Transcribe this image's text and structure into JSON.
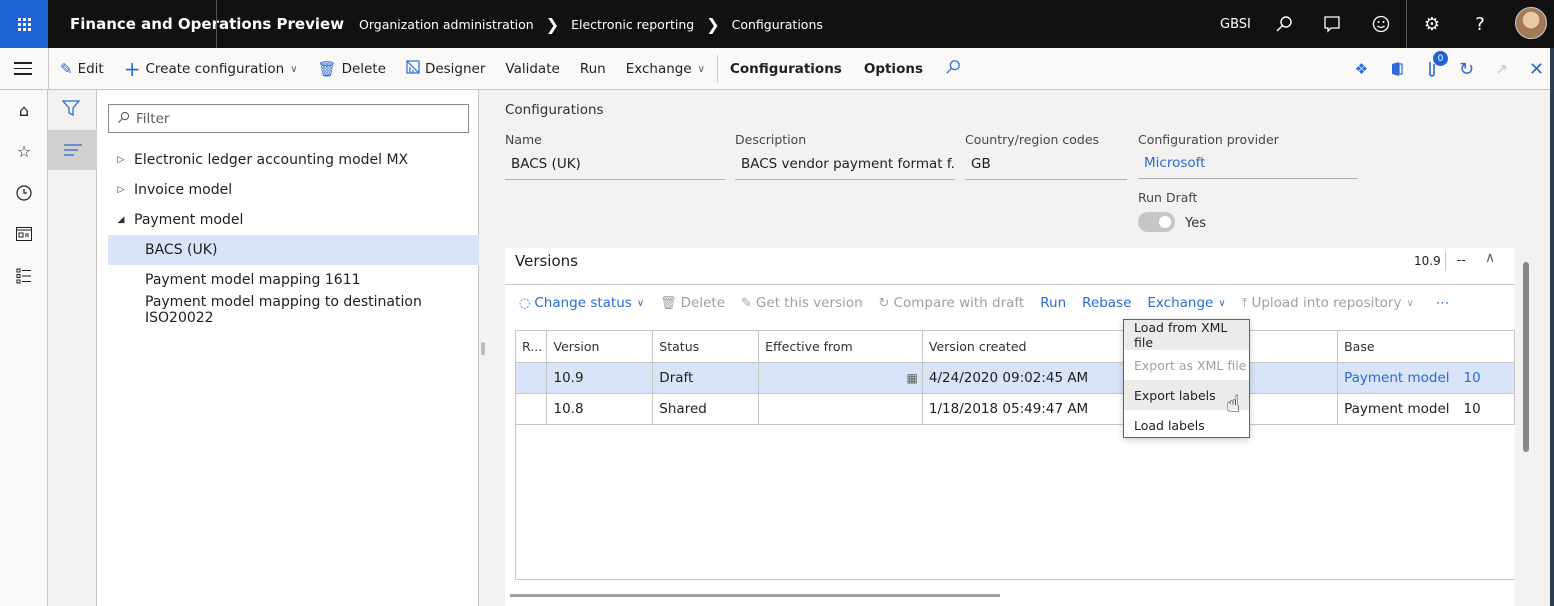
{
  "topbar": {
    "app_title": "Finance and Operations Preview",
    "breadcrumb": [
      "Organization administration",
      "Electronic reporting",
      "Configurations"
    ],
    "company": "GBSI",
    "icons": [
      "search-icon",
      "chat-icon",
      "smiley-icon",
      "gear-icon",
      "help-icon",
      "avatar"
    ]
  },
  "actionbar": {
    "edit": "Edit",
    "create_configuration": "Create configuration",
    "delete": "Delete",
    "designer": "Designer",
    "validate": "Validate",
    "run": "Run",
    "exchange": "Exchange",
    "configurations": "Configurations",
    "options": "Options",
    "notification_count": "0"
  },
  "tree": {
    "filter_placeholder": "Filter",
    "items": [
      {
        "label": "Electronic ledger accounting model MX",
        "state": "collapsed"
      },
      {
        "label": "Invoice model",
        "state": "collapsed"
      },
      {
        "label": "Payment model",
        "state": "expanded"
      },
      {
        "label": "BACS (UK)",
        "selected": true
      },
      {
        "label": "Payment model mapping 1611"
      },
      {
        "label": "Payment model mapping to destination ISO20022"
      }
    ]
  },
  "details": {
    "section": "Configurations",
    "name_label": "Name",
    "name_value": "BACS (UK)",
    "description_label": "Description",
    "description_value": "BACS vendor payment format f...",
    "country_label": "Country/region codes",
    "country_value": "GB",
    "provider_label": "Configuration provider",
    "provider_value": "Microsoft",
    "run_draft_label": "Run Draft",
    "run_draft_value": "Yes"
  },
  "versions": {
    "title": "Versions",
    "summary_version": "10.9",
    "summary_status": "--",
    "actions": {
      "change_status": "Change status",
      "delete": "Delete",
      "get_this_version": "Get this version",
      "compare_with_draft": "Compare with draft",
      "run": "Run",
      "rebase": "Rebase",
      "exchange": "Exchange",
      "upload_into_repository": "Upload into repository",
      "more": "⋯"
    },
    "columns": [
      "R...",
      "Version",
      "Status",
      "Effective from",
      "Version created",
      "",
      "Base"
    ],
    "rows": [
      {
        "version": "10.9",
        "status": "Draft",
        "effective_from": "",
        "created": "4/24/2020 09:02:45 AM",
        "base_name": "Payment model",
        "base_version": "10",
        "selected": true
      },
      {
        "version": "10.8",
        "status": "Shared",
        "effective_from": "",
        "created": "1/18/2018 05:49:47 AM",
        "base_name": "Payment model",
        "base_version": "10"
      }
    ]
  },
  "exchange_menu": {
    "items": [
      {
        "label": "Load from XML file",
        "enabled": true
      },
      {
        "label": "Export as XML file",
        "enabled": false
      },
      {
        "label": "Export labels",
        "enabled": true,
        "hovered": true
      },
      {
        "label": "Load labels",
        "enabled": true
      }
    ]
  }
}
